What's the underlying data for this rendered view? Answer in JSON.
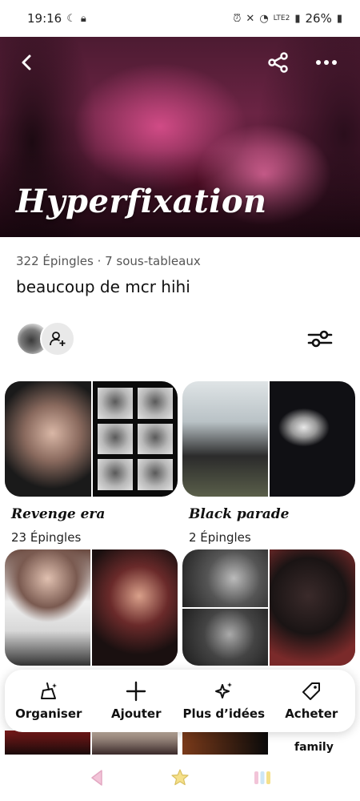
{
  "status_bar": {
    "time": "19:16",
    "battery": "26%",
    "network": "LTE2",
    "icons": [
      "moon-icon",
      "lock-icon",
      "alarm-icon",
      "mute-icon",
      "wifi-icon",
      "signal-icon",
      "battery-icon"
    ]
  },
  "board": {
    "title": "Hyperfixation",
    "meta": "322 Épingles · 7 sous-tableaux",
    "description": "beaucoup de mcr hihi"
  },
  "sections": [
    {
      "title": "Revenge era",
      "count": "23 Épingles"
    },
    {
      "title": "Black parade",
      "count": "2 Épingles"
    }
  ],
  "action_bar": {
    "organize": "Organiser",
    "add": "Ajouter",
    "more_ideas": "Plus d’idées",
    "shop": "Acheter"
  },
  "peek_text": "family",
  "colors": {
    "cover_accent": "#d14b86",
    "text": "#111111",
    "muted": "#555555"
  }
}
